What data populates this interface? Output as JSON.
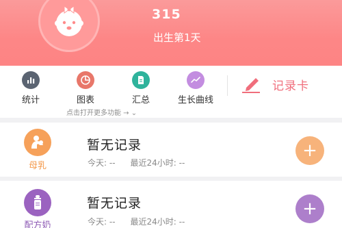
{
  "profile": {
    "name": "315",
    "age_text": "出生第1天"
  },
  "toolbar": {
    "items": [
      {
        "label": "统计",
        "icon": "bar-chart-icon",
        "color": "#5b6472"
      },
      {
        "label": "图表",
        "icon": "pie-chart-icon",
        "color": "#e8776a"
      },
      {
        "label": "汇总",
        "icon": "document-icon",
        "color": "#2fb39c"
      },
      {
        "label": "生长曲线",
        "icon": "growth-curve-icon",
        "color": "#c38de0"
      }
    ],
    "record_card_label": "记录卡",
    "record_card_icon": "pencil-icon",
    "record_card_color": "#f06e7c",
    "more_hint": "点击打开更多功能 → ⌄"
  },
  "cards": [
    {
      "label": "母乳",
      "label_color": "#f49a4c",
      "icon": "mother-breastfeeding-icon",
      "icon_bg": "#f6a15a",
      "title": "暂无记录",
      "today_label": "今天: --",
      "recent_label": "最近24小时: --",
      "plus_color": "#f7b37b",
      "plus_symbol": "+"
    },
    {
      "label": "配方奶",
      "label_color": "#8e5bb5",
      "icon": "baby-bottle-icon",
      "icon_bg": "#9b63c0",
      "title": "暂无记录",
      "today_label": "今天: --",
      "recent_label": "最近24小时: --",
      "plus_color": "#ad7fcb",
      "plus_symbol": "+"
    }
  ]
}
